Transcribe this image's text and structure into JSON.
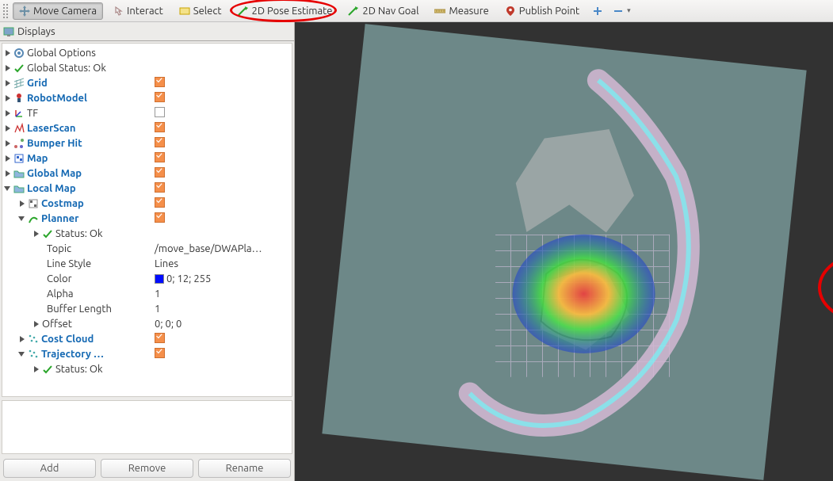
{
  "toolbar": {
    "move_camera": "Move Camera",
    "interact": "Interact",
    "select": "Select",
    "pose_estimate": "2D Pose Estimate",
    "nav_goal": "2D Nav Goal",
    "measure": "Measure",
    "publish_point": "Publish Point"
  },
  "panel": {
    "title": "Displays"
  },
  "tree": {
    "global_options": "Global Options",
    "global_status": "Global Status: Ok",
    "grid": "Grid",
    "robot_model": "RobotModel",
    "tf": "TF",
    "laserscan": "LaserScan",
    "bumper_hit": "Bumper Hit",
    "map": "Map",
    "global_map": "Global Map",
    "local_map": "Local Map",
    "costmap": "Costmap",
    "planner": "Planner",
    "planner_status": "Status: Ok",
    "planner_topic_label": "Topic",
    "planner_topic_value": "/move_base/DWAPla…",
    "planner_linestyle_label": "Line Style",
    "planner_linestyle_value": "Lines",
    "planner_color_label": "Color",
    "planner_color_value": "0; 12; 255",
    "planner_color_hex": "#000cff",
    "planner_alpha_label": "Alpha",
    "planner_alpha_value": "1",
    "planner_buflen_label": "Buffer Length",
    "planner_buflen_value": "1",
    "planner_offset_label": "Offset",
    "planner_offset_value": "0; 0; 0",
    "cost_cloud": "Cost Cloud",
    "trajectory": "Trajectory …",
    "trajectory_status": "Status: Ok"
  },
  "buttons": {
    "add": "Add",
    "remove": "Remove",
    "rename": "Rename"
  }
}
